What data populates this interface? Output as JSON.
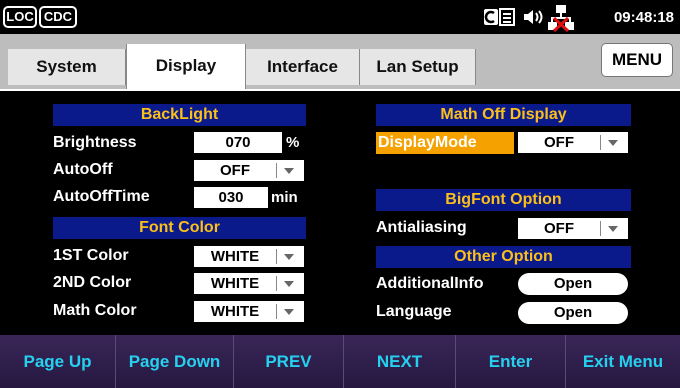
{
  "status": {
    "loc": "LOC",
    "cdc": "CDC",
    "icon_names": [
      "keyboard-icon",
      "speaker-icon",
      "network-disconnected-icon"
    ],
    "time": "09:48:18"
  },
  "tabs": [
    "System",
    "Display",
    "Interface",
    "Lan Setup"
  ],
  "active_tab": "Display",
  "menu_label": "MENU",
  "backlight": {
    "title": "BackLight",
    "brightness_label": "Brightness",
    "brightness_value": "070",
    "brightness_unit": "%",
    "autooff_label": "AutoOff",
    "autooff_value": "OFF",
    "autoofftime_label": "AutoOffTime",
    "autoofftime_value": "030",
    "autoofftime_unit": "min"
  },
  "font_color": {
    "title": "Font Color",
    "first_label": "1ST Color",
    "first_value": "WHITE",
    "second_label": "2ND Color",
    "second_value": "WHITE",
    "math_label": "Math Color",
    "math_value": "WHITE"
  },
  "math_off": {
    "title": "Math Off Display",
    "mode_label": "DisplayMode",
    "mode_value": "OFF"
  },
  "bigfont": {
    "title": "BigFont Option",
    "antialiasing_label": "Antialiasing",
    "antialiasing_value": "OFF"
  },
  "other": {
    "title": "Other Option",
    "additional_label": "AdditionalInfo",
    "additional_button": "Open",
    "language_label": "Language",
    "language_button": "Open"
  },
  "softkeys": [
    "Page Up",
    "Page Down",
    "PREV",
    "NEXT",
    "Enter",
    "Exit Menu"
  ],
  "colors": {
    "header_bg": "#0b1a8a",
    "header_text": "#fbbf1a",
    "highlight": "#f5a100",
    "softkey_text": "#26d1ef",
    "softkey_bg": "#2d1d46"
  }
}
